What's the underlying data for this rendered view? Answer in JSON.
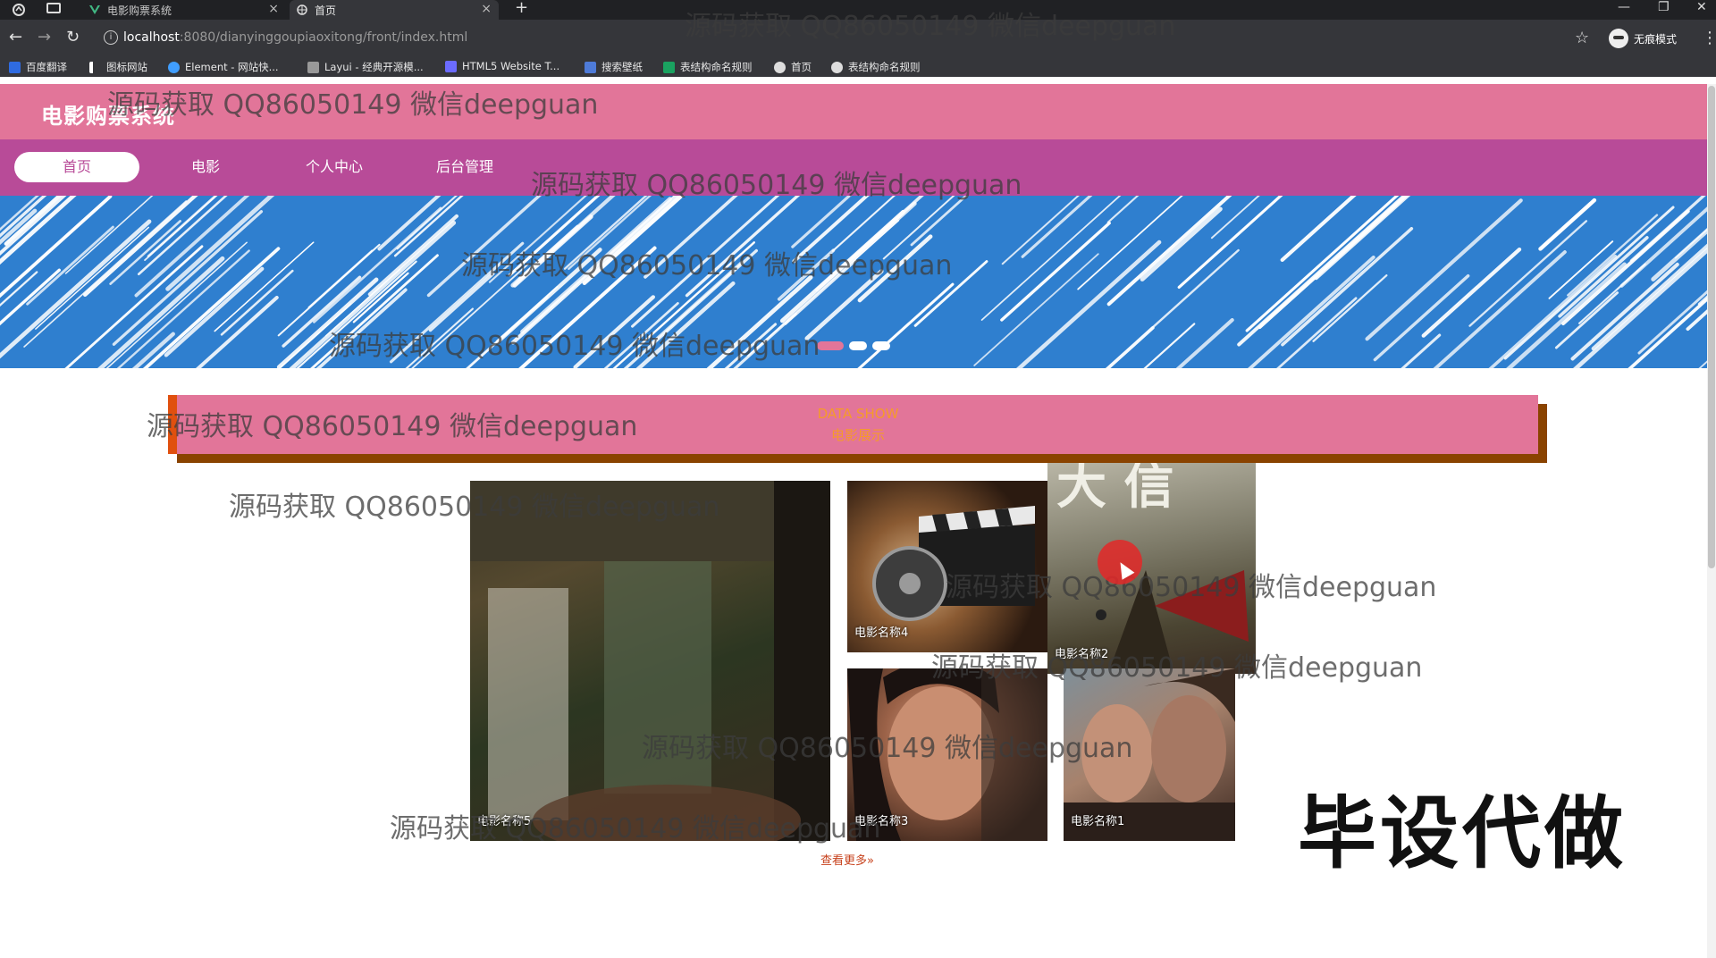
{
  "browser": {
    "tabs": [
      {
        "title": "电影购票系统",
        "icon": "vue-logo-icon"
      },
      {
        "title": "首页",
        "icon": "globe-icon"
      }
    ],
    "url_host": "localhost",
    "url_path": ":8080/dianyinggoupiaoxitong/front/index.html",
    "incognito_label": "无痕模式",
    "bookmarks": [
      {
        "label": "百度翻译",
        "color": "#2f6be0"
      },
      {
        "label": "图标网站",
        "color": "#ffffff"
      },
      {
        "label": "Element - 网站快...",
        "color": "#409eff"
      },
      {
        "label": "Layui - 经典开源模...",
        "color": "#cccccc"
      },
      {
        "label": "HTML5 Website T...",
        "color": "#6b6bff"
      },
      {
        "label": "搜索壁纸",
        "color": "#4e7bd8"
      },
      {
        "label": "表结构命名规则",
        "color": "#1aa260"
      },
      {
        "label": "首页",
        "color": "#dddddd"
      },
      {
        "label": "表结构命名规则",
        "color": "#dddddd"
      }
    ]
  },
  "site": {
    "title": "电影购票系统",
    "nav": [
      {
        "label": "首页",
        "active": true
      },
      {
        "label": "电影",
        "active": false
      },
      {
        "label": "个人中心",
        "active": false
      },
      {
        "label": "后台管理",
        "active": false
      }
    ],
    "banner_dots": 3,
    "banner_active_dot": 0
  },
  "data_show": {
    "title_en": "DATA SHOW",
    "title_cn": "电影展示"
  },
  "movies": [
    {
      "name": "电影名称5"
    },
    {
      "name": "电影名称4"
    },
    {
      "name": "电影名称2"
    },
    {
      "name": "电影名称3"
    },
    {
      "name": "电影名称1"
    }
  ],
  "more_link": "查看更多»",
  "promo_text": "毕设代做",
  "watermark_text": "源码获取 QQ86050149 微信deepguan",
  "colors": {
    "header": "#e27599",
    "nav": "#b84b98",
    "banner": "#2f7fcf",
    "accent_orange": "#f59b2a",
    "bar_left": "#e0500f"
  }
}
